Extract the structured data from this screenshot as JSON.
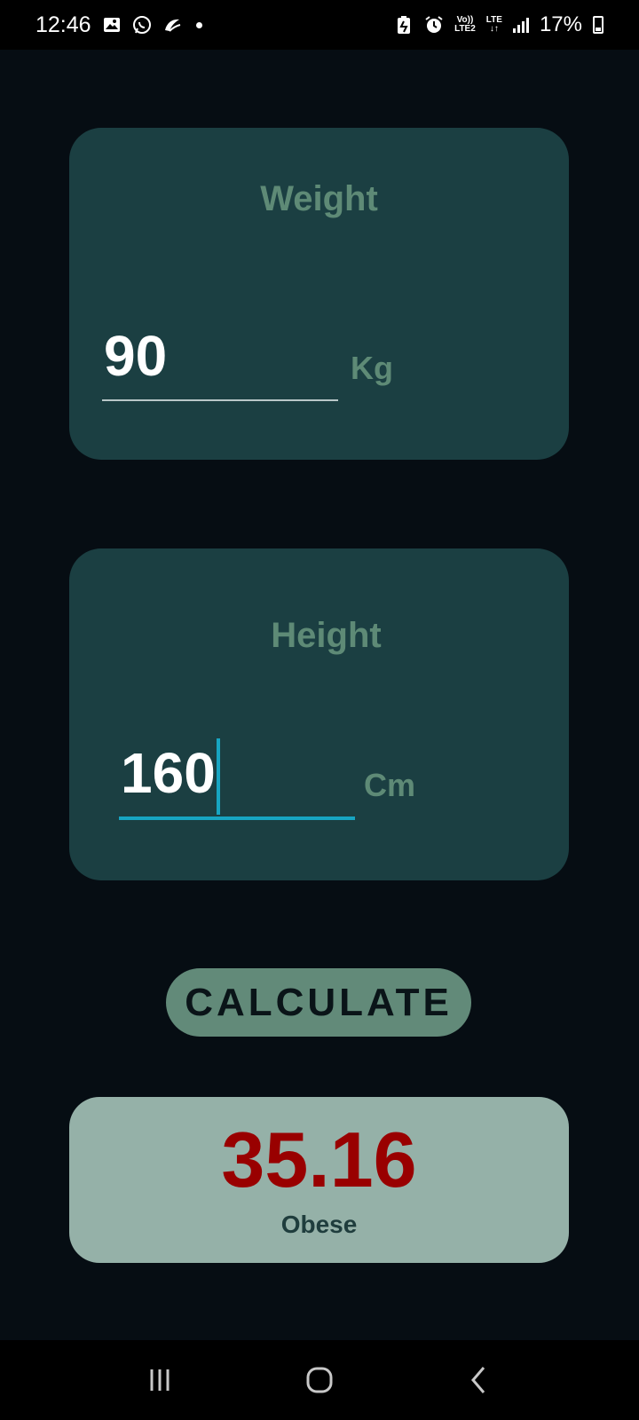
{
  "status_bar": {
    "time": "12:46",
    "battery": "17%",
    "lte_top": "LTE",
    "volte_top": "Vo))",
    "volte_bottom": "LTE2",
    "icons": [
      "gallery-icon",
      "whatsapp-icon",
      "app-icon",
      "notification-dot",
      "battery-saver-icon",
      "alarm-icon",
      "volte-icon",
      "lte-icon",
      "signal-icon",
      "battery-icon"
    ]
  },
  "weight": {
    "title": "Weight",
    "value": "90",
    "unit": "Kg"
  },
  "height": {
    "title": "Height",
    "value": "160",
    "unit": "Cm"
  },
  "calculate_label": "CALCULATE",
  "result": {
    "value": "35.16",
    "label": "Obese"
  },
  "colors": {
    "background": "#060d13",
    "card": "#1b3f42",
    "label": "#5e8a76",
    "button": "#628a79",
    "result_card": "#95b1a8",
    "result_value": "#990000",
    "focus": "#17a5c2"
  },
  "nav_bar": {
    "icons": [
      "recents-icon",
      "home-icon",
      "back-icon"
    ]
  }
}
